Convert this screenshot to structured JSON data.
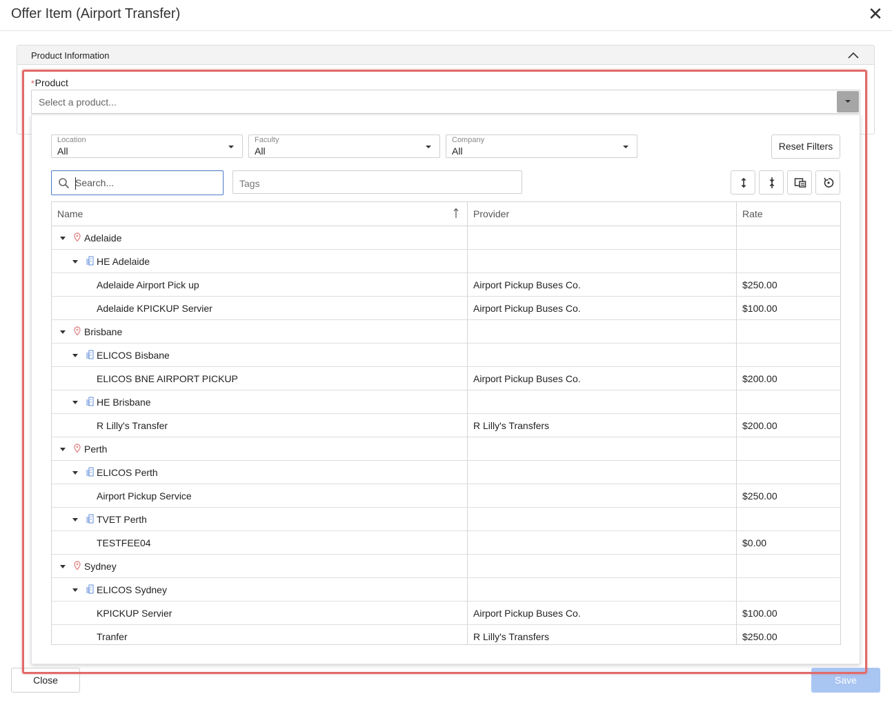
{
  "dialog": {
    "title": "Offer Item (Airport Transfer)",
    "close_icon": "close-icon"
  },
  "section": {
    "title": "Product Information",
    "collapse_icon": "chevron-up-icon"
  },
  "product": {
    "required_mark": "*",
    "label": "Product",
    "placeholder": "Select a product..."
  },
  "filters": {
    "location": {
      "label": "Location",
      "value": "All"
    },
    "faculty": {
      "label": "Faculty",
      "value": "All"
    },
    "company": {
      "label": "Company",
      "value": "All"
    },
    "reset_label": "Reset Filters"
  },
  "search": {
    "placeholder": "Search...",
    "tags_placeholder": "Tags"
  },
  "toolbar": {
    "icons": [
      "expand-all-icon",
      "collapse-all-icon",
      "column-chooser-icon",
      "reset-layout-icon"
    ]
  },
  "grid": {
    "columns": {
      "name": "Name",
      "provider": "Provider",
      "rate": "Rate"
    },
    "sort": "ascending",
    "rows": [
      {
        "level": 0,
        "kind": "location",
        "name": "Adelaide",
        "provider": "",
        "rate": ""
      },
      {
        "level": 1,
        "kind": "faculty",
        "name": "HE Adelaide",
        "provider": "",
        "rate": ""
      },
      {
        "level": 2,
        "kind": "item",
        "name": "Adelaide Airport Pick up",
        "provider": "Airport Pickup Buses Co.",
        "rate": "$250.00"
      },
      {
        "level": 2,
        "kind": "item",
        "name": "Adelaide KPICKUP Servier",
        "provider": "Airport Pickup Buses Co.",
        "rate": "$100.00"
      },
      {
        "level": 0,
        "kind": "location",
        "name": "Brisbane",
        "provider": "",
        "rate": ""
      },
      {
        "level": 1,
        "kind": "faculty",
        "name": "ELICOS Bisbane",
        "provider": "",
        "rate": ""
      },
      {
        "level": 2,
        "kind": "item",
        "name": "ELICOS BNE AIRPORT PICKUP",
        "provider": "Airport Pickup Buses Co.",
        "rate": "$200.00"
      },
      {
        "level": 1,
        "kind": "faculty",
        "name": "HE Brisbane",
        "provider": "",
        "rate": ""
      },
      {
        "level": 2,
        "kind": "item",
        "name": "R Lilly's Transfer",
        "provider": "R Lilly's Transfers",
        "rate": "$200.00"
      },
      {
        "level": 0,
        "kind": "location",
        "name": "Perth",
        "provider": "",
        "rate": ""
      },
      {
        "level": 1,
        "kind": "faculty",
        "name": "ELICOS Perth",
        "provider": "",
        "rate": ""
      },
      {
        "level": 2,
        "kind": "item",
        "name": "Airport Pickup Service",
        "provider": "",
        "rate": "$250.00"
      },
      {
        "level": 1,
        "kind": "faculty",
        "name": "TVET Perth",
        "provider": "",
        "rate": ""
      },
      {
        "level": 2,
        "kind": "item",
        "name": "TESTFEE04",
        "provider": "",
        "rate": "$0.00"
      },
      {
        "level": 0,
        "kind": "location",
        "name": "Sydney",
        "provider": "",
        "rate": ""
      },
      {
        "level": 1,
        "kind": "faculty",
        "name": "ELICOS Sydney",
        "provider": "",
        "rate": ""
      },
      {
        "level": 2,
        "kind": "item",
        "name": "KPICKUP Servier",
        "provider": "Airport Pickup Buses Co.",
        "rate": "$100.00"
      },
      {
        "level": 2,
        "kind": "item",
        "name": "Tranfer",
        "provider": "R Lilly's Transfers",
        "rate": "$250.00"
      }
    ]
  },
  "footer": {
    "close_label": "Close",
    "save_label": "Save"
  },
  "colors": {
    "accent": "#4a78c8",
    "highlight": "#e06b6b",
    "save_disabled": "#a9c5f2",
    "location_pin": "#e08a8a",
    "faculty_icon": "#7a9fe0"
  }
}
